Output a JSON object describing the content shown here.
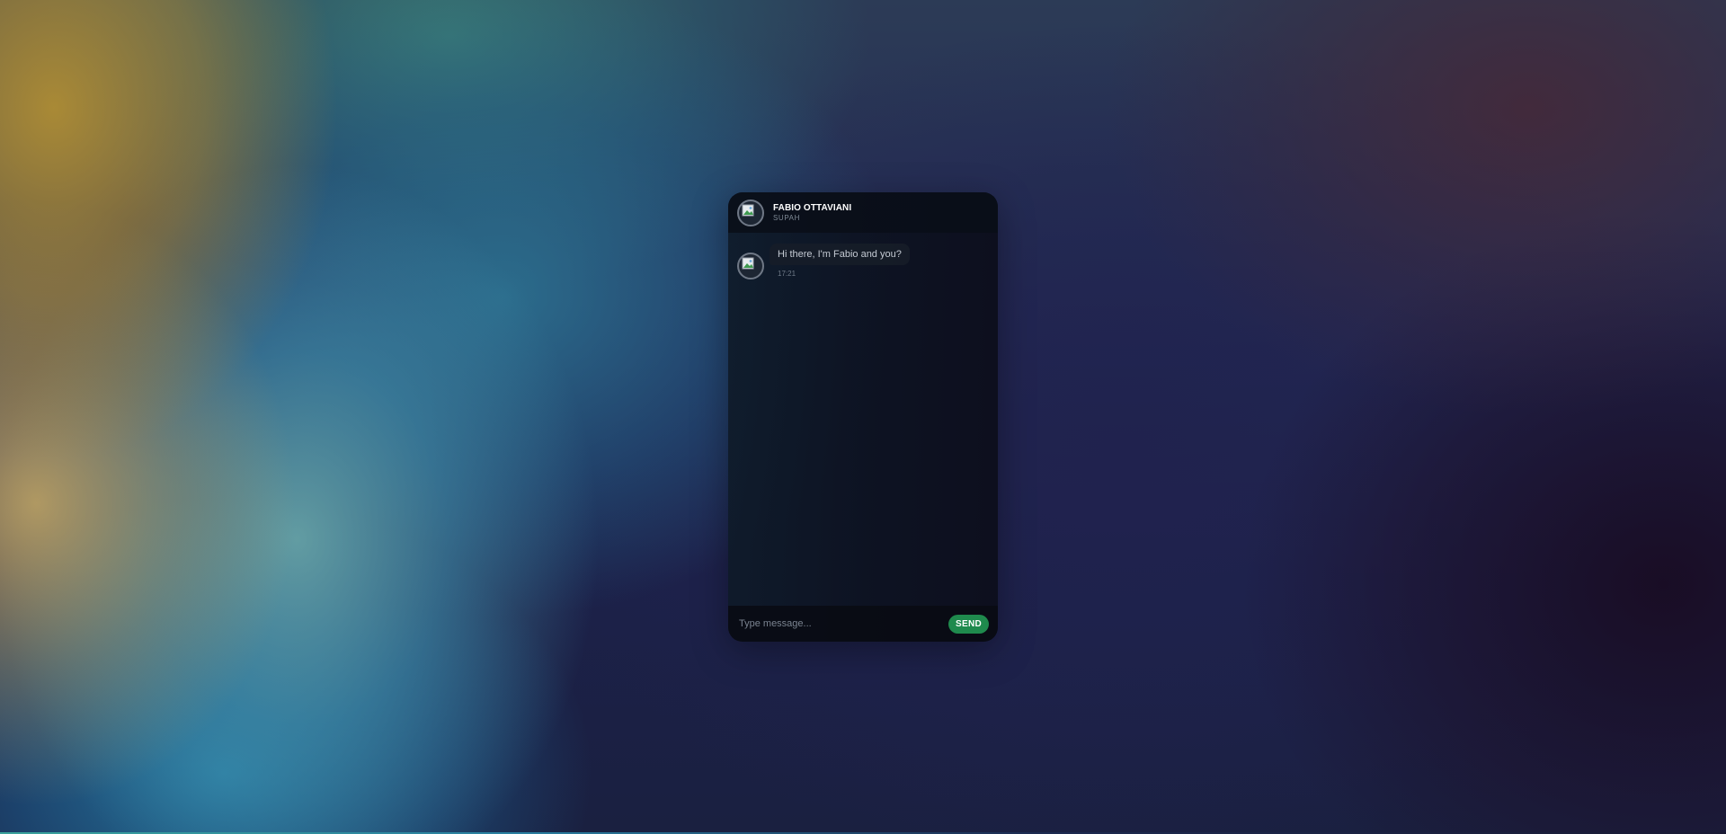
{
  "chat": {
    "header": {
      "name": "FABIO OTTAVIANI",
      "subtitle": "SUPAH",
      "avatar_icon": "broken-image-icon"
    },
    "messages": [
      {
        "text": "Hi there, I'm Fabio and you?",
        "time": "17:21",
        "avatar_icon": "broken-image-icon"
      }
    ],
    "input": {
      "placeholder": "Type message..."
    },
    "send_label": "SEND"
  },
  "colors": {
    "send_button": "#1f8a4d",
    "panel": "#0e1424"
  }
}
